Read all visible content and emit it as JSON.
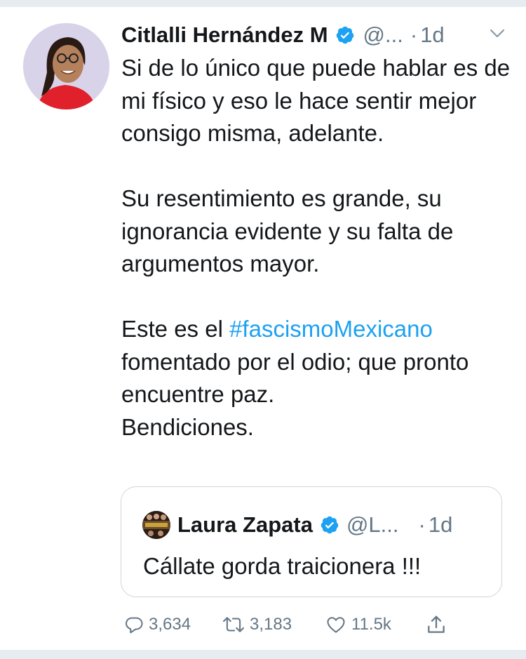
{
  "tweet": {
    "display_name": "Citlalli Hernández M",
    "handle": "@...",
    "separator": "·",
    "time": "1d",
    "paragraph_1": "Si de lo único que puede hablar es de mi físico y eso le hace sentir mejor consigo misma, adelante.",
    "paragraph_2": "Su resentimiento es grande, su ignorancia evidente y su falta de argumentos mayor.",
    "paragraph_3_start": "Este es el ",
    "hashtag": "#fascismoMexicano",
    "paragraph_3_end": "fomentado por el odio; que pronto encuentre paz.",
    "paragraph_4": "Bendiciones."
  },
  "quote": {
    "display_name": "Laura Zapata",
    "handle": "@L...",
    "separator": "·",
    "time": "1d",
    "text": "Cállate gorda traicionera !!!"
  },
  "actions": {
    "replies": "3,634",
    "retweets": "3,183",
    "likes": "11.5k"
  },
  "icons": [
    "verified-badge-icon",
    "chevron-down-icon",
    "reply-icon",
    "retweet-icon",
    "like-icon",
    "share-icon"
  ],
  "colors": {
    "link": "#1da1f2",
    "secondary_text": "#657786",
    "verified": "#1da1f2",
    "border": "#ccd6dd"
  }
}
